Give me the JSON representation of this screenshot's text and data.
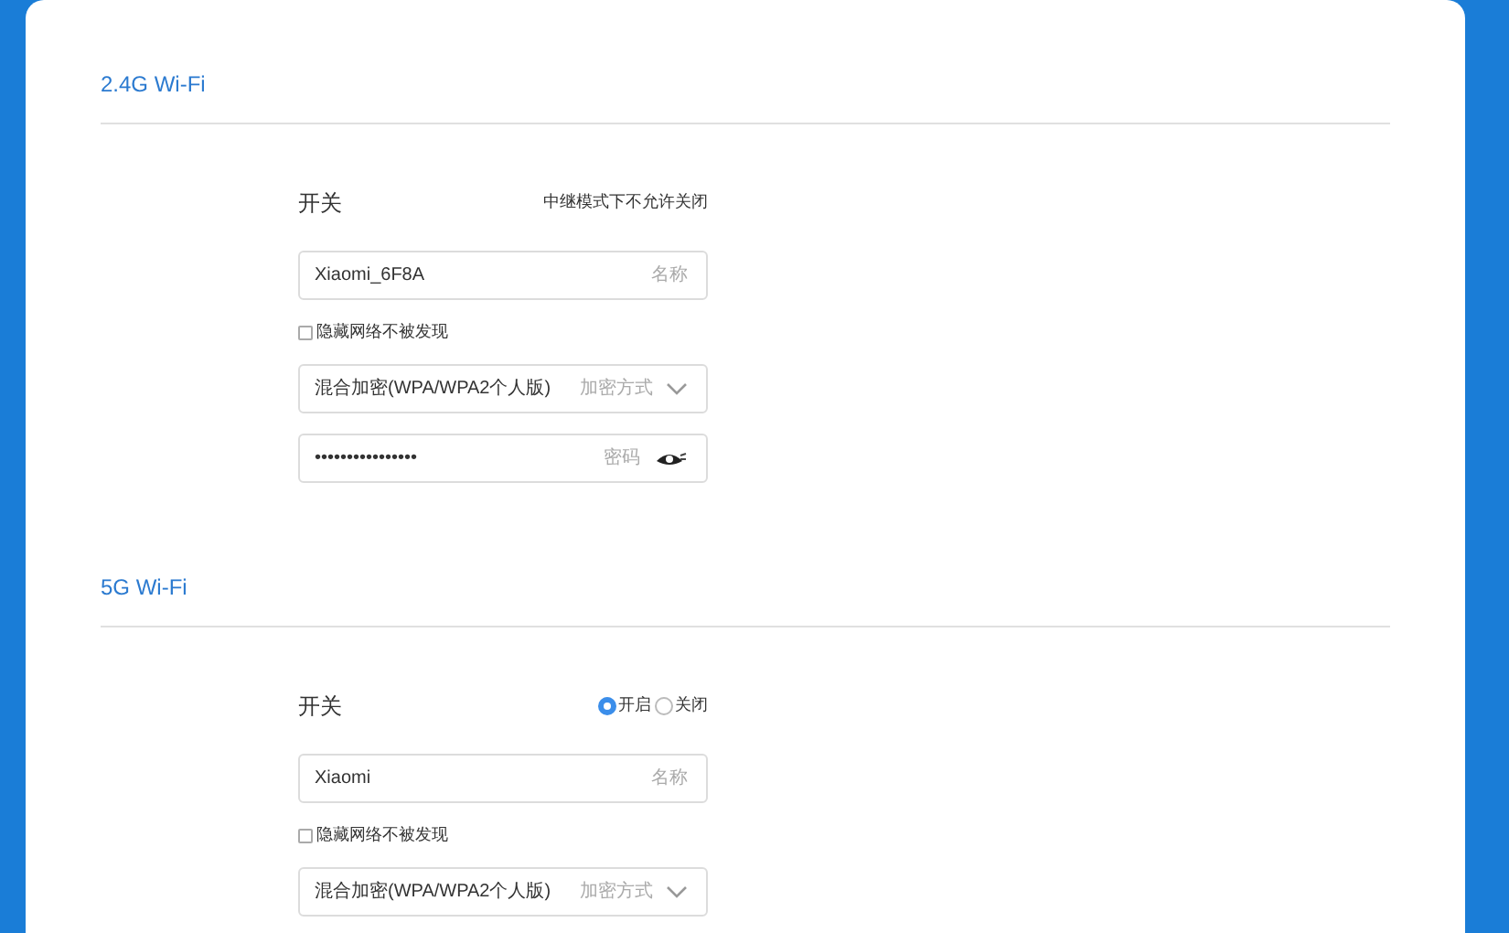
{
  "sections": [
    {
      "title": "2.4G Wi-Fi",
      "switch": {
        "label": "开关",
        "kind": "note",
        "note": "中继模式下不允许关闭"
      },
      "name": {
        "value": "Xiaomi_6F8A",
        "label": "名称"
      },
      "hide": {
        "label": "隐藏网络不被发现",
        "checked": false
      },
      "encryption": {
        "value": "混合加密(WPA/WPA2个人版)",
        "label": "加密方式"
      },
      "password": {
        "value": "••••••••••••••••",
        "label": "密码"
      }
    },
    {
      "title": "5G Wi-Fi",
      "switch": {
        "label": "开关",
        "kind": "radio",
        "options": [
          {
            "label": "开启",
            "selected": true
          },
          {
            "label": "关闭",
            "selected": false
          }
        ]
      },
      "name": {
        "value": "Xiaomi",
        "label": "名称"
      },
      "hide": {
        "label": "隐藏网络不被发现",
        "checked": false
      },
      "encryption": {
        "value": "混合加密(WPA/WPA2个人版)",
        "label": "加密方式"
      }
    }
  ]
}
